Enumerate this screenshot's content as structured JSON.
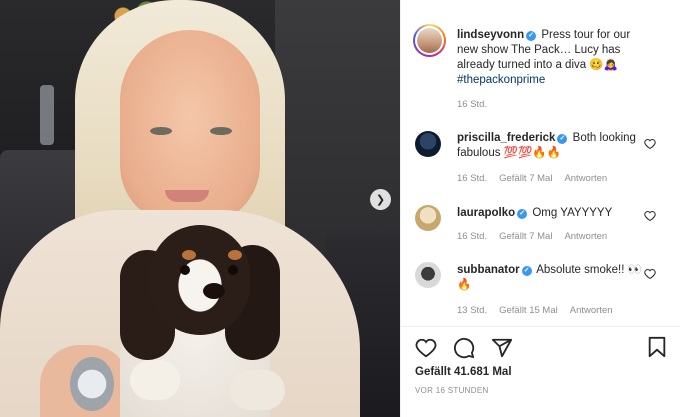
{
  "post": {
    "next_icon": "chevron-right-icon"
  },
  "caption": {
    "username": "lindseyvonn",
    "text": "Press tour for our new show The Pack… Lucy has already turned into a diva 🥴🙇‍♀️",
    "hashtag": "#thepackonprime",
    "time": "16 Std."
  },
  "comments": [
    {
      "username": "priscilla_frederick",
      "text": "Both looking fabulous 💯💯🔥🔥",
      "time": "16 Std.",
      "likes": "Gefällt 7 Mal",
      "reply": "Antworten"
    },
    {
      "username": "laurapolko",
      "text": "Omg YAYYYYY",
      "time": "16 Std.",
      "likes": "Gefällt 7 Mal",
      "reply": "Antworten"
    },
    {
      "username": "subbanator",
      "text": "Absolute smoke!! 👀🔥",
      "time": "13 Std.",
      "likes": "Gefällt 15 Mal",
      "reply": "Antworten"
    }
  ],
  "footer": {
    "likes": "Gefällt 41.681 Mal",
    "posted": "VOR 16 STUNDEN"
  },
  "colors": {
    "verified": "#3897f0",
    "hashtag": "#00376b",
    "muted": "#8e8e8e"
  }
}
